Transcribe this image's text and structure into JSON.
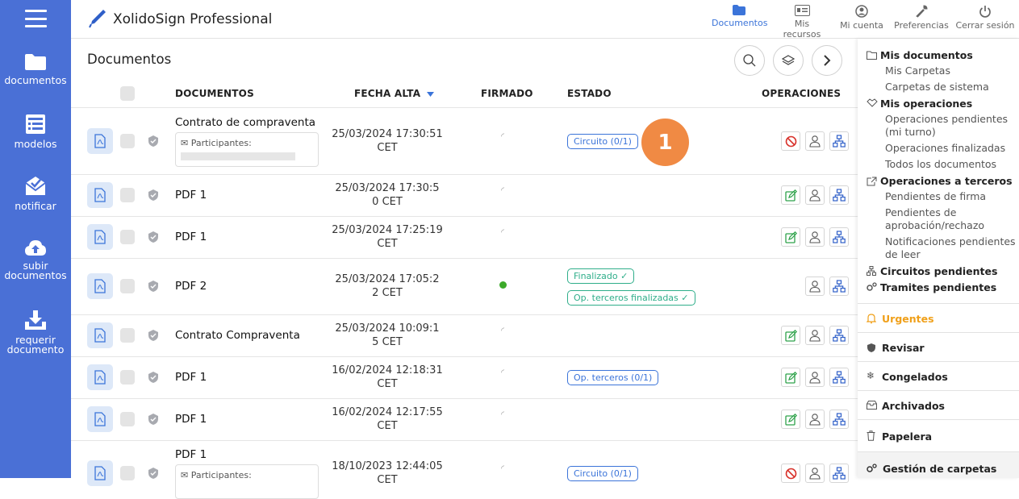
{
  "app": {
    "title": "XolidoSign Professional"
  },
  "sidebar": {
    "items": [
      {
        "label": "documentos"
      },
      {
        "label": "modelos"
      },
      {
        "label": "notificar"
      },
      {
        "label_line1": "subir",
        "label_line2": "documentos"
      },
      {
        "label_line1": "requerir",
        "label_line2": "documento"
      }
    ]
  },
  "topnav": {
    "documentos": "Documentos",
    "recursos": "Mis recursos",
    "cuenta": "Mi cuenta",
    "preferencias": "Preferencias",
    "cerrar": "Cerrar sesión"
  },
  "main": {
    "title": "Documentos",
    "columns": {
      "documentos": "DOCUMENTOS",
      "fecha": "FECHA ALTA",
      "firmado": "FIRMADO",
      "estado": "ESTADO",
      "operaciones": "OPERACIONES"
    },
    "participants_label": "Participantes:",
    "step_number": "1",
    "rows": [
      {
        "name": "Contrato de compraventa",
        "date1": "25/03/2024 17:30:51",
        "date2": "CET",
        "badge1": "Circuito (0/1)"
      },
      {
        "name": "PDF 1",
        "date1": "25/03/2024 17:30:5",
        "date2": "0 CET"
      },
      {
        "name": "PDF 1",
        "date1": "25/03/2024 17:25:19",
        "date2": "CET"
      },
      {
        "name": "PDF 2",
        "date1": "25/03/2024 17:05:2",
        "date2": "2 CET",
        "badge1": "Finalizado",
        "badge2": "Op. terceros finalizadas"
      },
      {
        "name": "Contrato Compraventa",
        "date1": "25/03/2024 10:09:1",
        "date2": "5 CET"
      },
      {
        "name": "PDF 1",
        "date1": "16/02/2024 12:18:31",
        "date2": "CET",
        "badge1": "Op. terceros (0/1)"
      },
      {
        "name": "PDF 1",
        "date1": "16/02/2024 12:17:55",
        "date2": "CET"
      },
      {
        "name": "PDF 1",
        "date1": "18/10/2023 12:44:05",
        "date2": "CET",
        "badge1": "Circuito (0/1)"
      }
    ]
  },
  "rightpanel": {
    "mis_documentos": "Mis documentos",
    "mis_carpetas": "Mis Carpetas",
    "carpetas_sistema": "Carpetas de sistema",
    "mis_operaciones": "Mis operaciones",
    "op_pendientes": "Operaciones pendientes (mi turno)",
    "op_finalizadas": "Operaciones finalizadas",
    "todos": "Todos los documentos",
    "op_terceros": "Operaciones a terceros",
    "pend_firma": "Pendientes de firma",
    "pend_aprob": "Pendientes de aprobación/rechazo",
    "notif_pend": "Notificaciones pendientes de leer",
    "circuitos": "Circuitos pendientes",
    "tramites": "Tramites pendientes",
    "urgentes": "Urgentes",
    "revisar": "Revisar",
    "congelados": "Congelados",
    "archivados": "Archivados",
    "papelera": "Papelera",
    "gestion": "Gestión de carpetas"
  },
  "colors": {
    "sidebar": "#4a70d6",
    "accent": "#3b74d9",
    "step": "#f08a44",
    "urgent": "#f0a01a"
  }
}
